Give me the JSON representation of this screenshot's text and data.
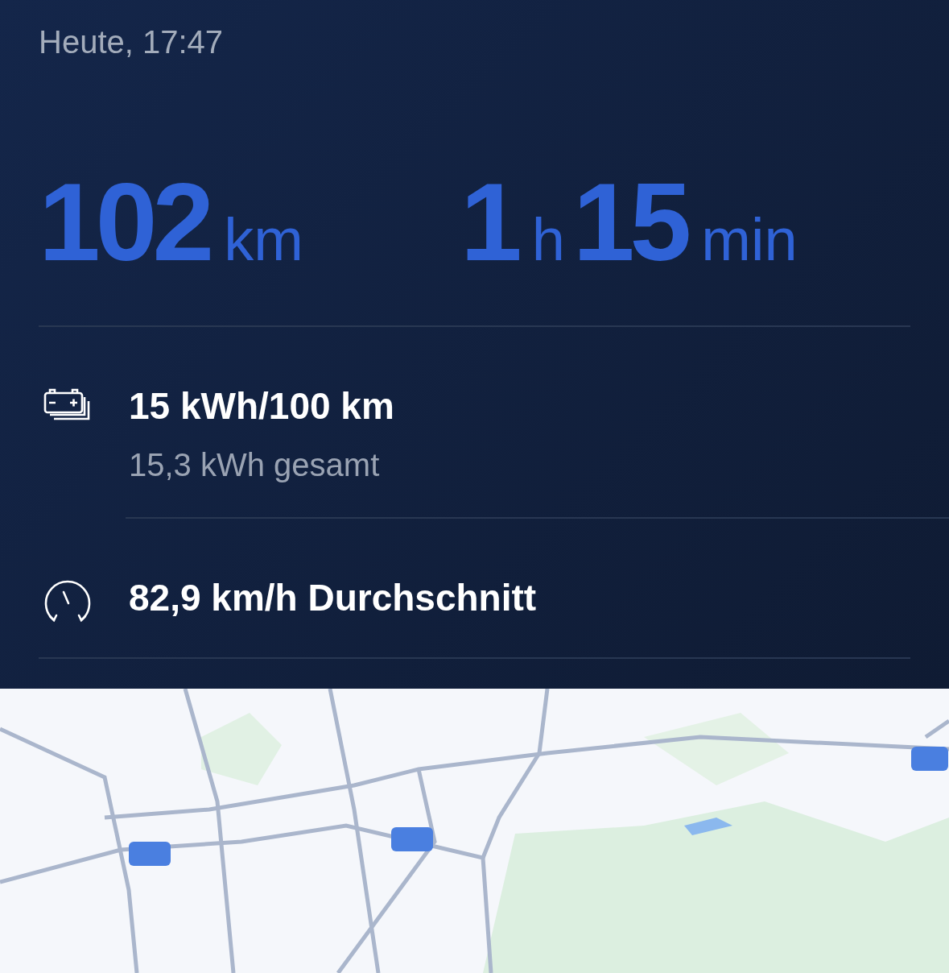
{
  "trip": {
    "time": "Heute, 17:47"
  },
  "summary": [
    {
      "parts": [
        {
          "kind": "value",
          "text": "102"
        },
        {
          "kind": "unit",
          "text": "km"
        }
      ]
    },
    {
      "parts": [
        {
          "kind": "value",
          "text": "1"
        },
        {
          "kind": "unit",
          "text": "h"
        },
        {
          "kind": "value",
          "text": "15"
        },
        {
          "kind": "unit",
          "text": "min"
        }
      ]
    }
  ],
  "stats": [
    {
      "kind": "consumption",
      "title": "15 kWh/100 km",
      "subtitle": "15,3 kWh gesamt"
    },
    {
      "kind": "speed",
      "title": "82,9 km/h Durchschnitt"
    }
  ]
}
